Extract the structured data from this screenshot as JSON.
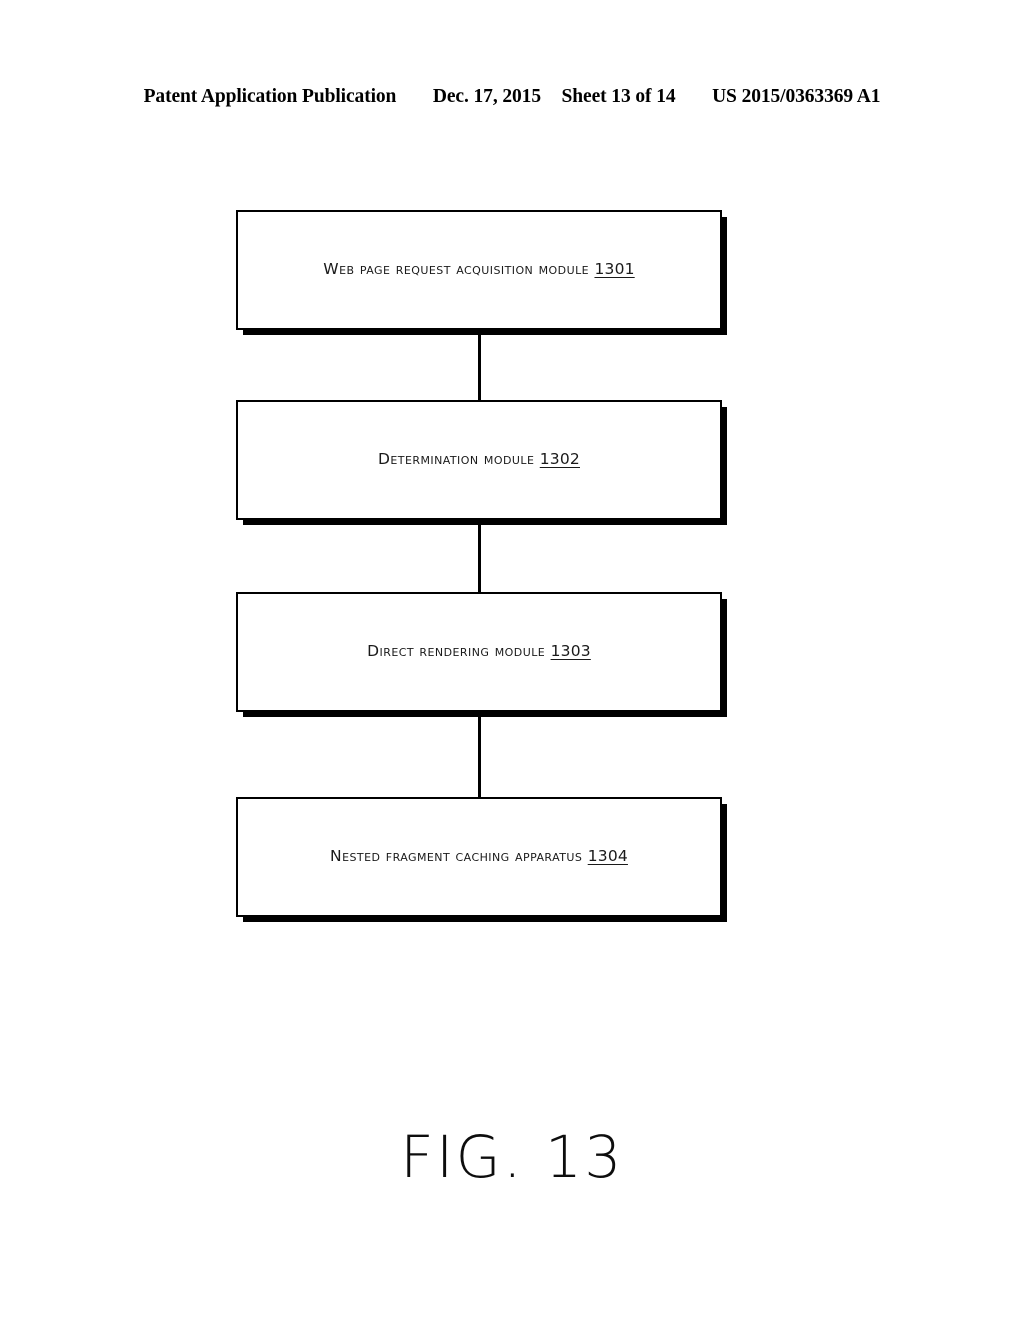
{
  "header": {
    "publication": "Patent Application Publication",
    "date": "Dec. 17, 2015",
    "sheet": "Sheet 13 of 14",
    "publication_number": "US 2015/0363369 A1"
  },
  "figure": {
    "caption": "FIG. 13",
    "type": "block-diagram",
    "line_color": "#000000",
    "background_color": "#ffffff",
    "boxes": [
      {
        "label": "Web page request acquisition module",
        "ref": "1301"
      },
      {
        "label": "Determination module",
        "ref": "1302"
      },
      {
        "label": "Direct rendering module",
        "ref": "1303"
      },
      {
        "label": "Nested fragment caching apparatus",
        "ref": "1304"
      }
    ]
  }
}
